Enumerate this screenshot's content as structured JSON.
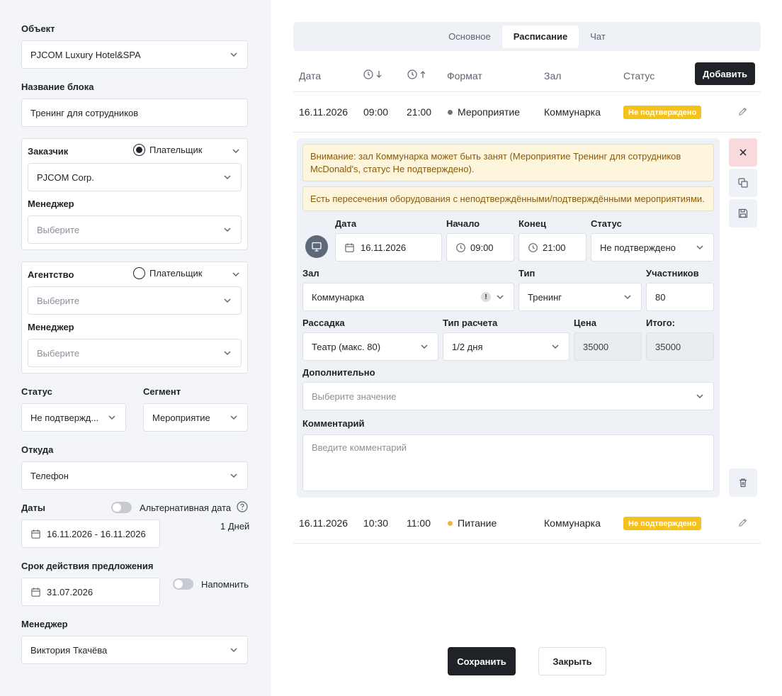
{
  "left": {
    "object": {
      "label": "Объект",
      "value": "PJCOM Luxury Hotel&SPA"
    },
    "block_name": {
      "label": "Название блока",
      "value": "Тренинг для сотрудников"
    },
    "customer": {
      "label": "Заказчик",
      "payer_label": "Плательщик",
      "payer_selected": true,
      "value": "PJCOM Corp.",
      "manager_label": "Менеджер",
      "manager_placeholder": "Выберите"
    },
    "agency": {
      "label": "Агентство",
      "payer_label": "Плательщик",
      "payer_selected": false,
      "placeholder": "Выберите",
      "manager_label": "Менеджер",
      "manager_placeholder": "Выберите"
    },
    "status": {
      "label": "Статус",
      "value": "Не подтвержд..."
    },
    "segment": {
      "label": "Сегмент",
      "value": "Мероприятие"
    },
    "source": {
      "label": "Откуда",
      "value": "Телефон"
    },
    "dates": {
      "label": "Даты",
      "alt_label": "Альтернативная дата",
      "value": "16.11.2026 - 16.11.2026",
      "days": "1 Дней"
    },
    "validity": {
      "label": "Срок действия предложения",
      "value": "31.07.2026",
      "remind_label": "Напомнить"
    },
    "manager": {
      "label": "Менеджер",
      "value": "Виктория Ткачёва"
    }
  },
  "tabs": [
    {
      "label": "Основное",
      "active": false
    },
    {
      "label": "Расписание",
      "active": true
    },
    {
      "label": "Чат",
      "active": false
    }
  ],
  "table": {
    "headers": {
      "date": "Дата",
      "format": "Формат",
      "hall": "Зал",
      "status": "Статус"
    },
    "add_button": "Добавить",
    "rows": [
      {
        "date": "16.11.2026",
        "start": "09:00",
        "end": "21:00",
        "format": "Мероприятие",
        "format_color": "#6b7380",
        "hall": "Коммунарка",
        "status": "Не подтверждено"
      },
      {
        "date": "16.11.2026",
        "start": "10:30",
        "end": "11:00",
        "format": "Питание",
        "format_color": "#f5b041",
        "hall": "Коммунарка",
        "status": "Не подтверждено"
      }
    ]
  },
  "editor": {
    "warning1": "Внимание: зал Коммунарка может быть занят (Мероприятие Тренинг для сотрудников McDonald's, статус Не подтверждено).",
    "warning2": "Есть пересечения оборудования с неподтверждёнными/подтверждёнными мероприятиями.",
    "date": {
      "label": "Дата",
      "value": "16.11.2026"
    },
    "start": {
      "label": "Начало",
      "value": "09:00"
    },
    "end": {
      "label": "Конец",
      "value": "21:00"
    },
    "status": {
      "label": "Статус",
      "value": "Не подтверждено"
    },
    "hall": {
      "label": "Зал",
      "value": "Коммунарка"
    },
    "type": {
      "label": "Тип",
      "value": "Тренинг"
    },
    "participants": {
      "label": "Участников",
      "value": "80"
    },
    "seating": {
      "label": "Рассадка",
      "value": "Театр (макс. 80)"
    },
    "calc_type": {
      "label": "Тип расчета",
      "value": "1/2 дня"
    },
    "price": {
      "label": "Цена",
      "value": "35000"
    },
    "total": {
      "label": "Итого:",
      "value": "35000"
    },
    "additional": {
      "label": "Дополнительно",
      "placeholder": "Выберите значение"
    },
    "comment": {
      "label": "Комментарий",
      "placeholder": "Введите комментарий"
    }
  },
  "footer": {
    "save": "Сохранить",
    "close": "Закрыть"
  },
  "colors": {
    "badge": "#f5c21b",
    "dark_button": "#1f2328",
    "left_bg": "#f3f5f8",
    "delete_bg": "#f9d9dc"
  }
}
